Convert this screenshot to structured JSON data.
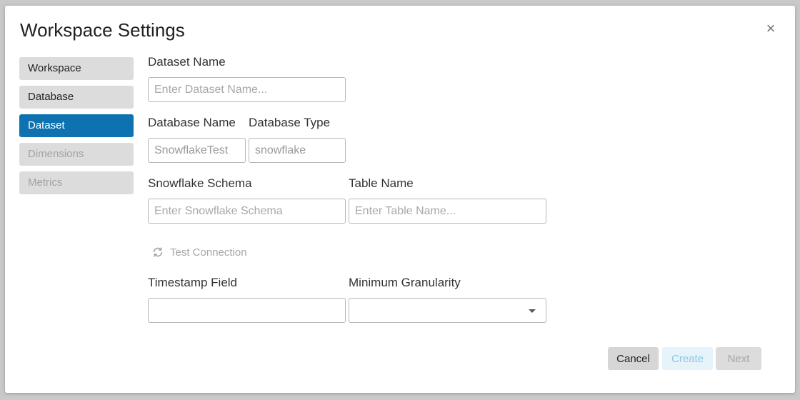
{
  "dialog": {
    "title": "Workspace Settings",
    "close_icon": "×"
  },
  "sidebar": {
    "items": [
      {
        "label": "Workspace",
        "state": "normal"
      },
      {
        "label": "Database",
        "state": "normal"
      },
      {
        "label": "Dataset",
        "state": "active"
      },
      {
        "label": "Dimensions",
        "state": "disabled"
      },
      {
        "label": "Metrics",
        "state": "disabled"
      }
    ]
  },
  "form": {
    "dataset_name": {
      "label": "Dataset Name",
      "value": "",
      "placeholder": "Enter Dataset Name..."
    },
    "database_name": {
      "label": "Database Name",
      "value": "SnowflakeTest",
      "placeholder": ""
    },
    "database_type": {
      "label": "Database Type",
      "value": "snowflake",
      "placeholder": ""
    },
    "snowflake_schema": {
      "label": "Snowflake Schema",
      "value": "",
      "placeholder": "Enter Snowflake Schema"
    },
    "table_name": {
      "label": "Table Name",
      "value": "",
      "placeholder": "Enter Table Name..."
    },
    "test_connection": {
      "label": "Test Connection",
      "icon": "refresh-icon"
    },
    "timestamp_field": {
      "label": "Timestamp Field",
      "value": ""
    },
    "minimum_granularity": {
      "label": "Minimum Granularity",
      "value": ""
    }
  },
  "footer": {
    "cancel_label": "Cancel",
    "create_label": "Create",
    "next_label": "Next"
  },
  "colors": {
    "accent": "#0f72b0",
    "create_text": "#8cc8e6",
    "disabled_text": "#a6a6a6"
  }
}
